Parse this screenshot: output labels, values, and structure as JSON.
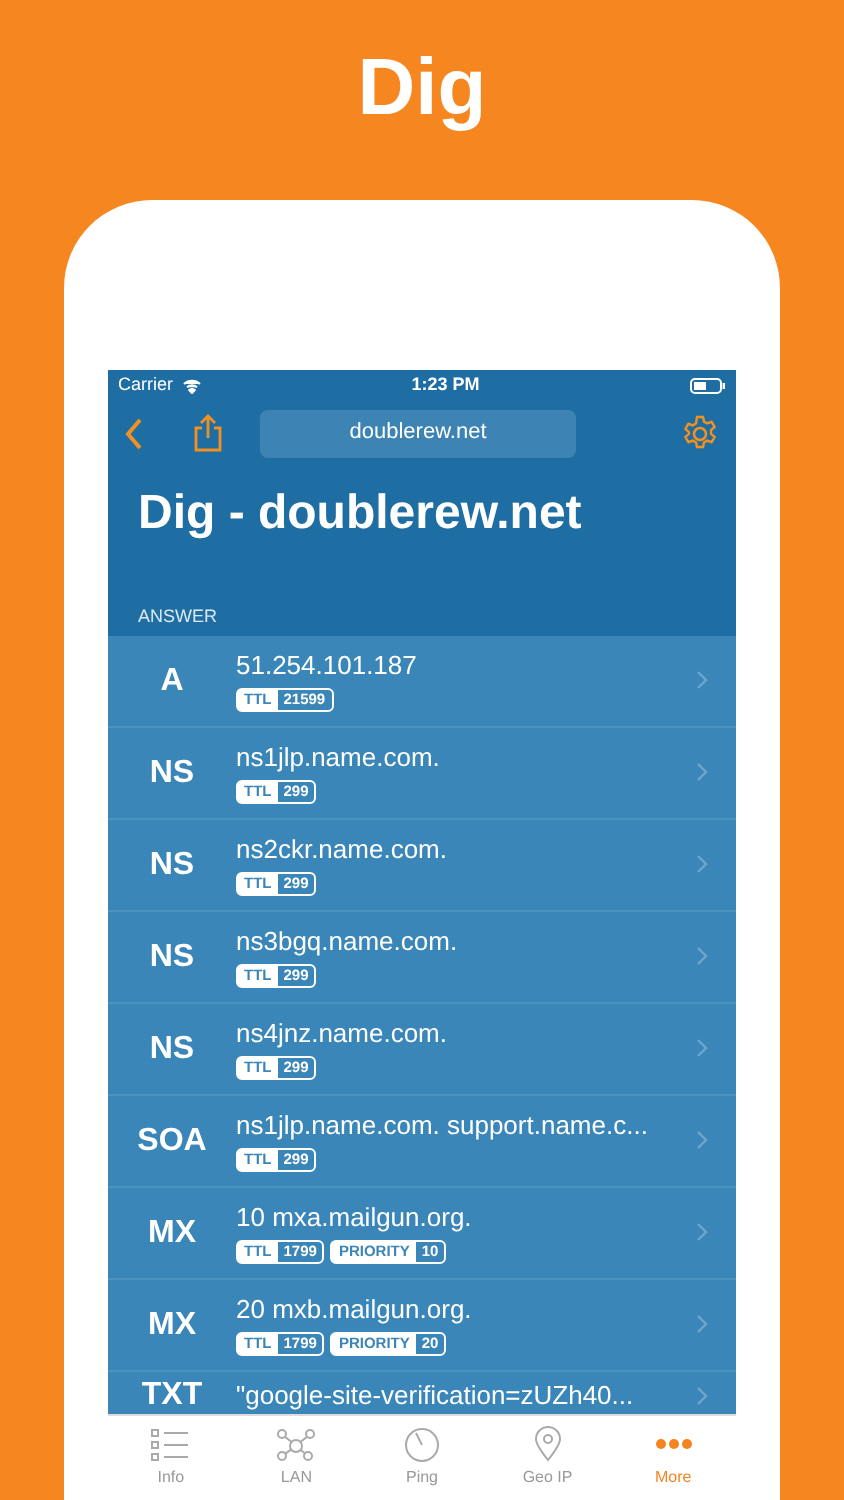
{
  "headline": "Dig",
  "status_bar": {
    "carrier": "Carrier",
    "time": "1:23 PM"
  },
  "nav_bar": {
    "host": "doublerew.net"
  },
  "title": "Dig - doublerew.net",
  "section": "ANSWER",
  "records": [
    {
      "type": "A",
      "value": "51.254.101.187",
      "tags": [
        {
          "key": "TTL",
          "value": "21599"
        }
      ]
    },
    {
      "type": "NS",
      "value": "ns1jlp.name.com.",
      "tags": [
        {
          "key": "TTL",
          "value": "299"
        }
      ]
    },
    {
      "type": "NS",
      "value": "ns2ckr.name.com.",
      "tags": [
        {
          "key": "TTL",
          "value": "299"
        }
      ]
    },
    {
      "type": "NS",
      "value": "ns3bgq.name.com.",
      "tags": [
        {
          "key": "TTL",
          "value": "299"
        }
      ]
    },
    {
      "type": "NS",
      "value": "ns4jnz.name.com.",
      "tags": [
        {
          "key": "TTL",
          "value": "299"
        }
      ]
    },
    {
      "type": "SOA",
      "value": "ns1jlp.name.com. support.name.c...",
      "tags": [
        {
          "key": "TTL",
          "value": "299"
        }
      ]
    },
    {
      "type": "MX",
      "value": "10 mxa.mailgun.org.",
      "tags": [
        {
          "key": "TTL",
          "value": "1799"
        },
        {
          "key": "PRIORITY",
          "value": "10"
        }
      ]
    },
    {
      "type": "MX",
      "value": "20 mxb.mailgun.org.",
      "tags": [
        {
          "key": "TTL",
          "value": "1799"
        },
        {
          "key": "PRIORITY",
          "value": "20"
        }
      ]
    },
    {
      "type": "TXT",
      "value": "\"google-site-verification=zUZh40..."
    }
  ],
  "tabs": [
    {
      "label": "Info",
      "kind": "list",
      "selected": false
    },
    {
      "label": "LAN",
      "kind": "network",
      "selected": false
    },
    {
      "label": "Ping",
      "kind": "gauge",
      "selected": false
    },
    {
      "label": "Geo IP",
      "kind": "pin",
      "selected": false
    },
    {
      "label": "More",
      "kind": "dots",
      "selected": true
    }
  ]
}
